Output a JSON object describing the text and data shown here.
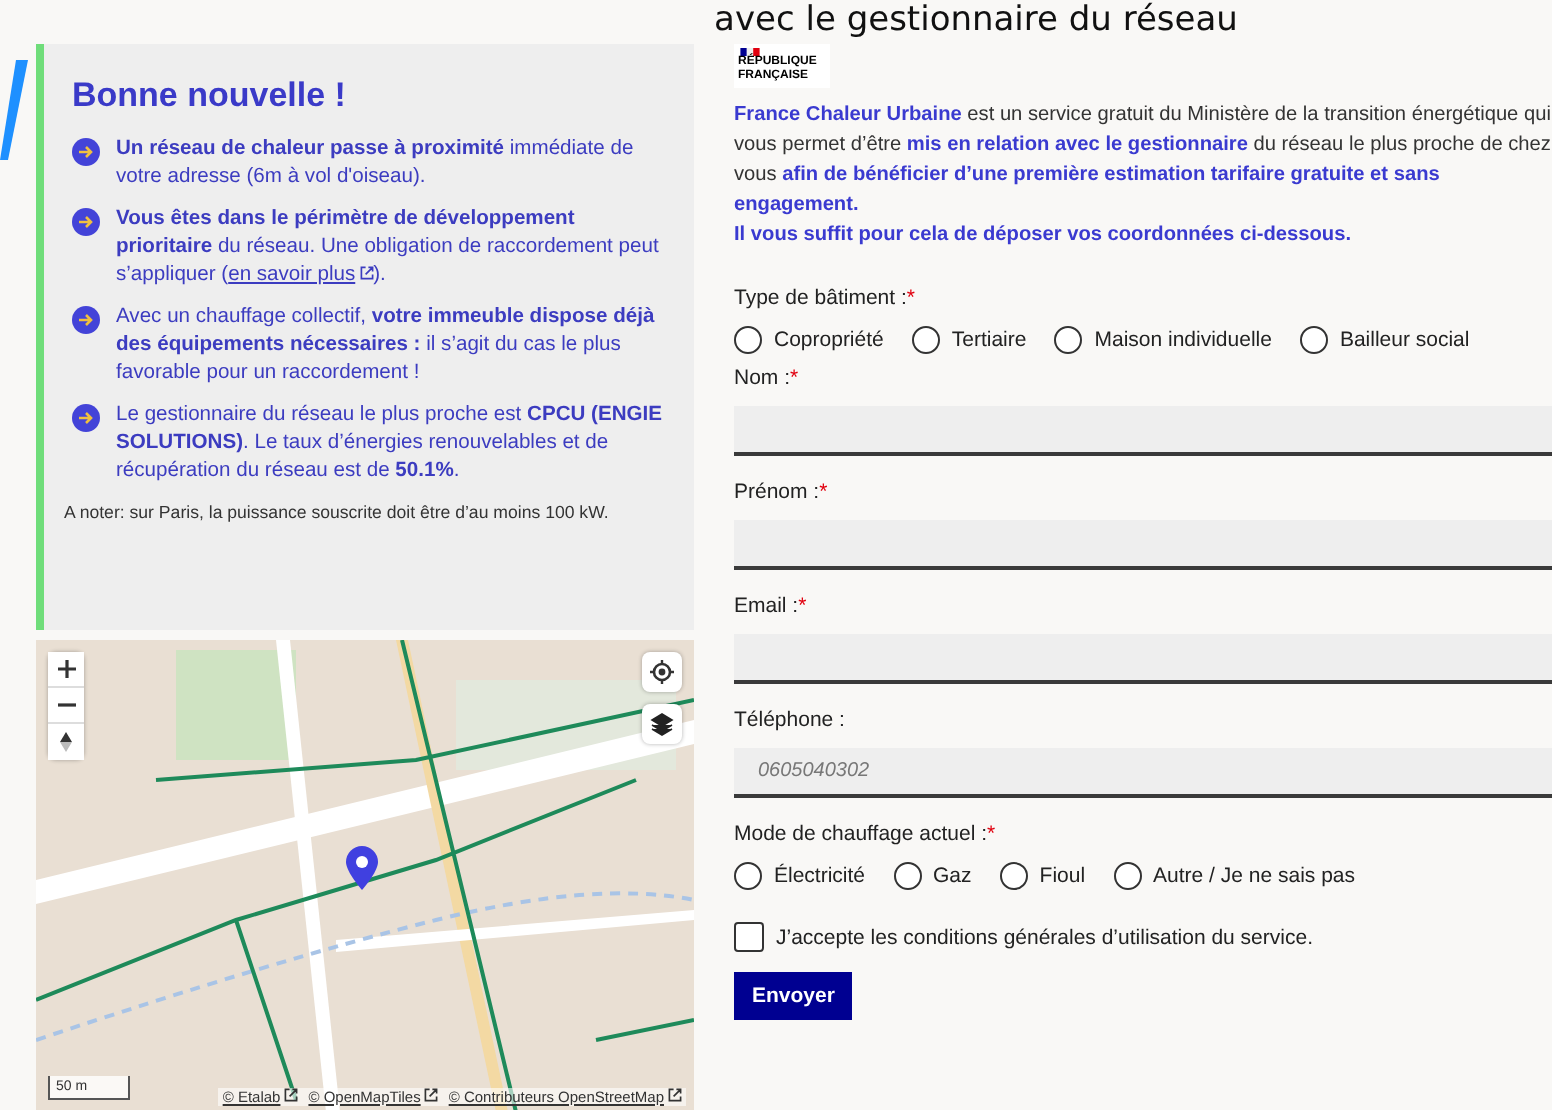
{
  "page_heading": "avec le gestionnaire du réseau",
  "result_card": {
    "title": "Bonne nouvelle !",
    "items": [
      {
        "text": "**Un réseau de chaleur passe à proximité** immédiate de votre adresse (6m à vol d'oiseau)."
      },
      {
        "text": "**Vous êtes dans le périmètre de développement prioritaire** du réseau. Une obligation de raccordement peut s’appliquer (",
        "link": "en savoir plus",
        "text_after": ")."
      },
      {
        "text": "Avec un chauffage collectif, **votre immeuble dispose déjà des équipements nécessaires :** il s’agit du cas le plus favorable pour un raccordement !"
      },
      {
        "text": "Le gestionnaire du réseau le plus proche est **CPCU (ENGIE SOLUTIONS)**. Le taux d’énergies renouvelables et de récupération du réseau est de **50.1%**."
      }
    ],
    "note": "A noter: sur Paris, la puissance souscrite doit être d’au moins 100 kW."
  },
  "map": {
    "scale": "50 m",
    "attributions": [
      "© Etalab",
      "© OpenMapTiles",
      "© Contributeurs OpenStreetMap"
    ]
  },
  "logo": {
    "text": "RÉPUBLIQUE FRANÇAISE"
  },
  "intro": "**France Chaleur Urbaine** est un service gratuit du Ministère de la transition énergétique qui vous permet d’être **mis en relation avec le gestionnaire** du réseau le plus proche de chez vous **afin de bénéficier d’une première estimation tarifaire gratuite et sans engagement.**",
  "intro_2": "Il vous suffit pour cela de déposer vos coordonnées ci-dessous.",
  "form": {
    "building_type": {
      "label": "Type de bâtiment :",
      "required_mark": "*",
      "options": [
        {
          "label": "Copropriété",
          "selected": false
        },
        {
          "label": "Tertiaire",
          "selected": false
        },
        {
          "label": "Maison individuelle",
          "selected": false
        },
        {
          "label": "Bailleur social",
          "selected": false
        }
      ]
    },
    "fields": [
      {
        "label": "Nom :",
        "required_mark": "*"
      },
      {
        "label": "Prénom :",
        "required_mark": "*"
      },
      {
        "label": "Email :",
        "required_mark": "*"
      },
      {
        "label": "Téléphone :",
        "placeholder": "0605040302"
      }
    ],
    "heating": {
      "label": "Mode de chauffage actuel :",
      "required_mark": "*",
      "options": [
        {
          "label": "Électricité",
          "selected": false
        },
        {
          "label": "Gaz",
          "selected": false
        },
        {
          "label": "Fioul",
          "selected": false
        },
        {
          "label": "Autre / Je ne sais pas",
          "selected": false
        }
      ]
    },
    "terms": {
      "label": "J’accepte les conditions générales d’utilisation du service.",
      "checked": false
    },
    "submit": "Envoyer"
  }
}
